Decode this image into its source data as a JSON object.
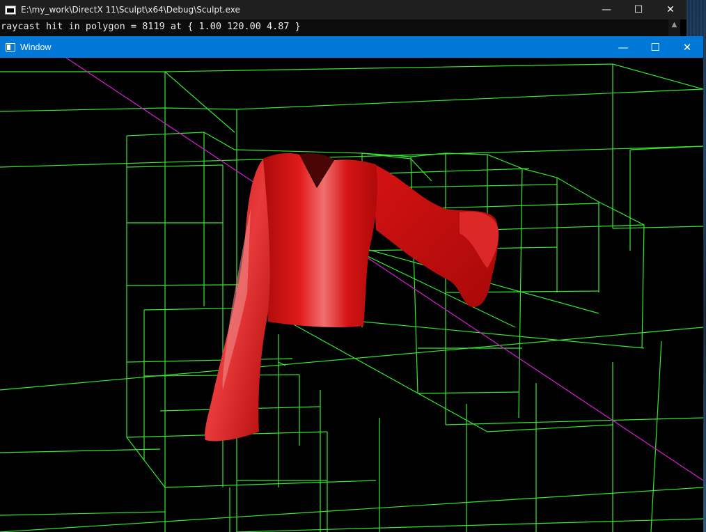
{
  "console": {
    "title": "E:\\my_work\\DirectX 11\\Sculpt\\x64\\Debug\\Sculpt.exe",
    "output": "raycast hit in polygon = 8119 at { 1.00 120.00 4.87 }"
  },
  "render_window": {
    "title": "Window"
  },
  "colors": {
    "octree_lines": "#35e82f",
    "ray": "#d11fd1",
    "mesh": "#d10f0f",
    "titlebar_active": "#0078d7",
    "console_bg": "#0c0c0c"
  },
  "icons": {
    "minimize": "minimize-icon",
    "maximize": "maximize-icon",
    "close": "close-icon"
  }
}
